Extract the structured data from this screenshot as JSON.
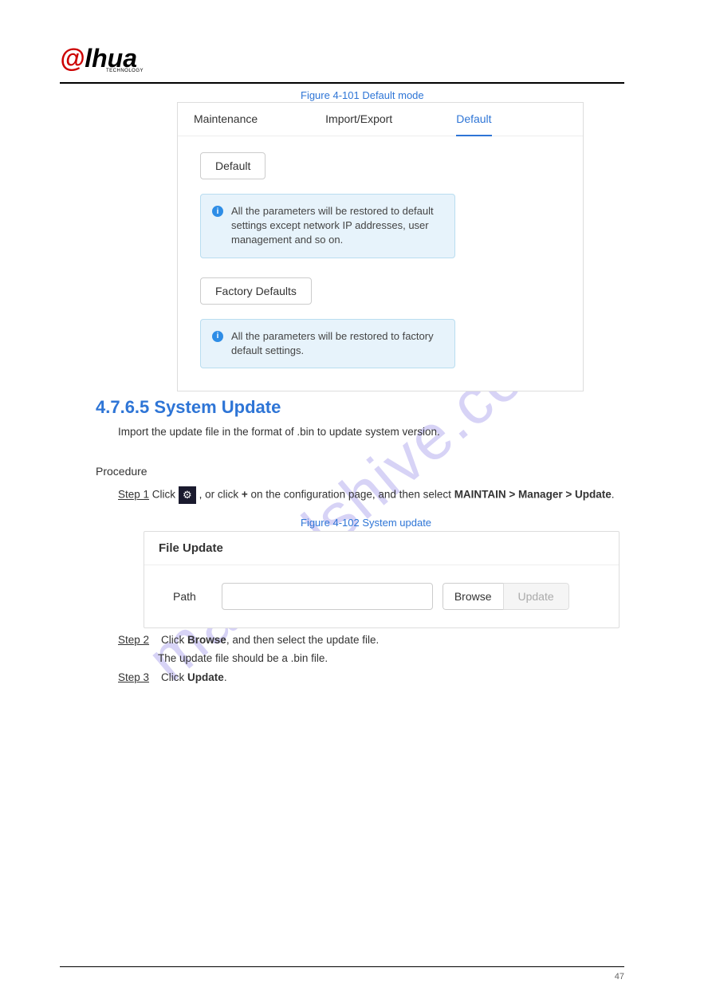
{
  "logo": {
    "brand": "alhua",
    "sub": "TECHNOLOGY"
  },
  "figure1_label": "Figure 4-101 Default mode",
  "figure2_label": "Figure 4-102 System update",
  "panel1": {
    "tabs": {
      "maintenance": "Maintenance",
      "importexport": "Import/Export",
      "default": "Default"
    },
    "default_btn": "Default",
    "info1": "All the parameters will be restored to default settings except network IP addresses, user management and so on.",
    "factory_btn": "Factory Defaults",
    "info2": "All the parameters will be restored to factory default settings."
  },
  "section_heading": "4.7.6.5 System Update",
  "desc": "Import the update file in the format of .bin to update system version.",
  "procedure_heading": "Procedure",
  "step1_prefix": "Step 1",
  "step1_text_a": "   Click ",
  "step1_text_b": ", or click ",
  "step1_plus": "+",
  "step1_text_c": " on the configuration page, and then select ",
  "step1_text_d": "MAINTAIN > Manager > Update",
  "panel2": {
    "header": "File Update",
    "path_label": "Path",
    "browse": "Browse",
    "update": "Update"
  },
  "step2_prefix": "Step 2",
  "step2_text": "Click Browse, and then select the update file.",
  "step2b_text": "The update file should be a .bin file.",
  "step3_prefix": "Step 3",
  "step3_text": "Click Update.",
  "footer": "47",
  "watermark": "manualshive.com"
}
